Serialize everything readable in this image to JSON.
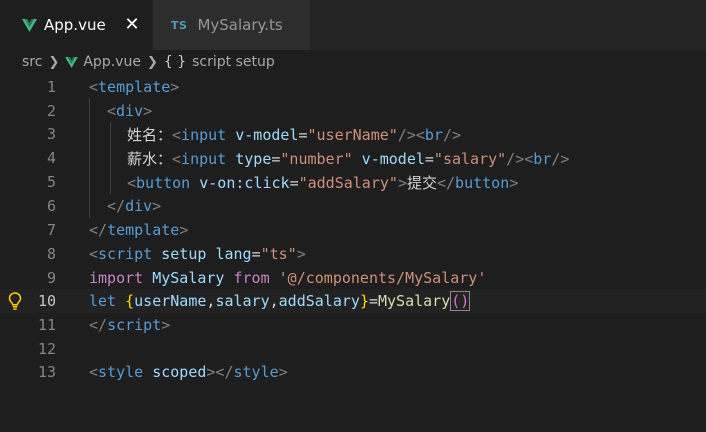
{
  "tabs": [
    {
      "label": "App.vue",
      "icon": "vue-icon",
      "active": true
    },
    {
      "label": "MySalary.ts",
      "icon": "ts-icon",
      "icon_text": "TS",
      "active": false
    }
  ],
  "breadcrumb": {
    "folder": "src",
    "file": "App.vue",
    "symbol": "script setup",
    "symbol_icon": "{ }"
  },
  "editor": {
    "current_line": 10,
    "lines": [
      {
        "n": "1"
      },
      {
        "n": "2"
      },
      {
        "n": "3"
      },
      {
        "n": "4"
      },
      {
        "n": "5"
      },
      {
        "n": "6"
      },
      {
        "n": "7"
      },
      {
        "n": "8"
      },
      {
        "n": "9"
      },
      {
        "n": "10"
      },
      {
        "n": "11"
      },
      {
        "n": "12"
      },
      {
        "n": "13"
      }
    ],
    "code": {
      "l1": {
        "open": "<",
        "tag": "template",
        "close": ">"
      },
      "l2": {
        "open": "<",
        "tag": "div",
        "close": ">"
      },
      "l3": {
        "label": "姓名：",
        "open": "<",
        "tag": "input",
        "attr": "v-model",
        "eq": "=",
        "val": "\"userName\"",
        "selfclose": "/>",
        "br_open": "<",
        "br": "br",
        "br_close": "/>"
      },
      "l4": {
        "label": "薪水：",
        "open": "<",
        "tag": "input",
        "attr1": "type",
        "eq1": "=",
        "val1": "\"number\"",
        "attr2": "v-model",
        "eq2": "=",
        "val2": "\"salary\"",
        "selfclose": "/>",
        "br_open": "<",
        "br": "br",
        "br_close": "/>"
      },
      "l5": {
        "open": "<",
        "tag": "button",
        "attr": "v-on:click",
        "eq": "=",
        "val": "\"addSalary\"",
        "gt": ">",
        "text": "提交",
        "end_open": "</",
        "end_tag": "button",
        "end_close": ">"
      },
      "l6": {
        "open": "</",
        "tag": "div",
        "close": ">"
      },
      "l7": {
        "open": "</",
        "tag": "template",
        "close": ">"
      },
      "l8": {
        "open": "<",
        "tag": "script",
        "attr1": "setup",
        "attr2": "lang",
        "eq": "=",
        "val": "\"ts\"",
        "close": ">"
      },
      "l9": {
        "kw": "import",
        "name": "MySalary",
        "from": "from",
        "path": "'@/components/MySalary'"
      },
      "l10": {
        "kw": "let",
        "lb": "{",
        "v1": "userName",
        "c1": ",",
        "v2": "salary",
        "c2": ",",
        "v3": "addSalary",
        "rb": "}",
        "eq": "=",
        "fn": "MySalary",
        "lp": "(",
        "rp": ")"
      },
      "l11": {
        "open": "</",
        "tag": "script",
        "close": ">"
      },
      "l13": {
        "open": "<",
        "tag": "style",
        "attr": "scoped",
        "close": "></",
        "end_tag": "style",
        "end_close": ">"
      }
    }
  },
  "colors": {
    "background": "#1e1e1e",
    "tab_bar": "#252526",
    "vue_green": "#41b883",
    "ts_blue": "#519aba",
    "bulb_yellow": "#ffcc00"
  }
}
